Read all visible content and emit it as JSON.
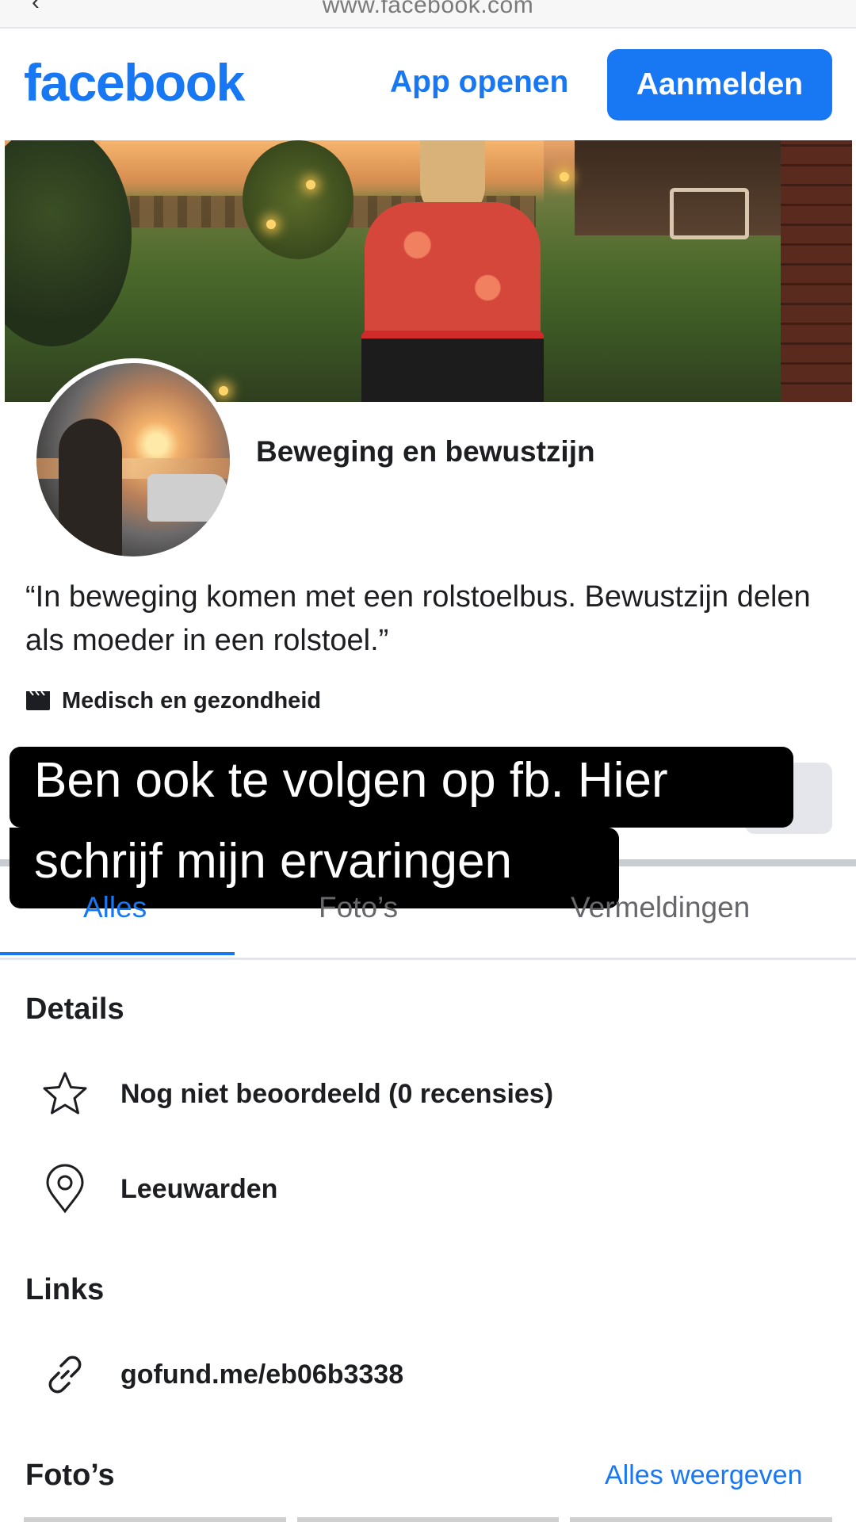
{
  "browser": {
    "url": "www.facebook.com",
    "back_glyph": "‹"
  },
  "header": {
    "logo": "facebook",
    "open_app": "App openen",
    "sign_in": "Aanmelden"
  },
  "page": {
    "name": "Beweging en bewustzijn",
    "intro": "“In beweging komen met een rolstoelbus. Bewustzijn delen als moeder in een rolstoel.”",
    "category": "Medisch en gezondheid"
  },
  "caption": {
    "line1": "Ben ook te volgen op fb. Hier",
    "line2": "schrijf mijn ervaringen"
  },
  "tabs": [
    {
      "label": "Alles",
      "active": true
    },
    {
      "label": "Foto’s",
      "active": false
    },
    {
      "label": "Vermeldingen",
      "active": false
    }
  ],
  "details": {
    "title": "Details",
    "rating": "Nog niet beoordeeld (0 recensies)",
    "location": "Leeuwarden"
  },
  "links": {
    "title": "Links",
    "url": "gofund.me/eb06b3338"
  },
  "photos": {
    "title": "Foto’s",
    "see_all": "Alles weergeven"
  },
  "colors": {
    "brand": "#1877f2",
    "text": "#1c1e21",
    "muted": "#65676b"
  }
}
